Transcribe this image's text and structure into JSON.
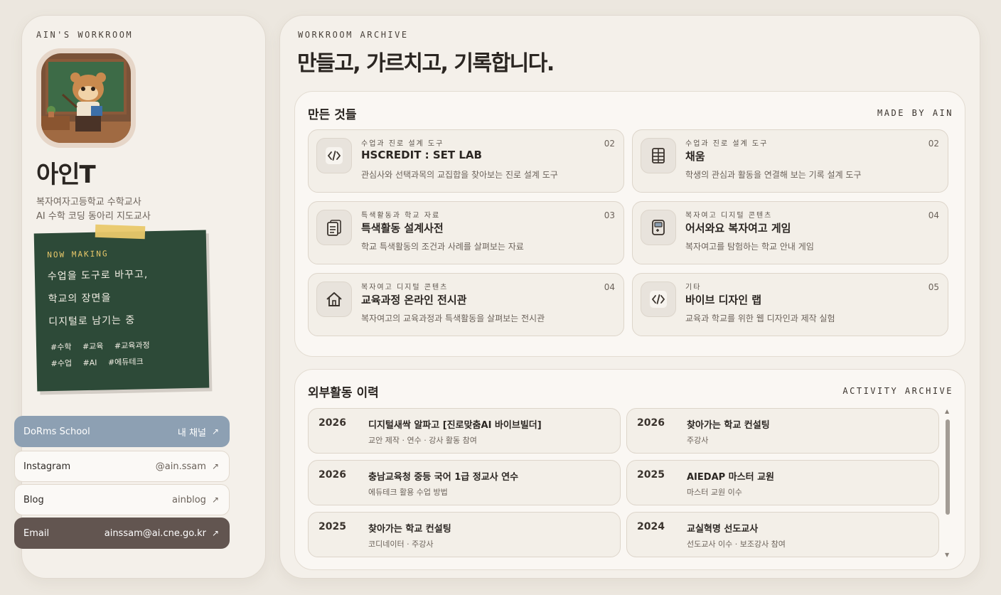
{
  "profile": {
    "eyebrow": "AIN'S WORKROOM",
    "name": "아인T",
    "role_line1": "복자여자고등학교 수학교사",
    "role_line2": "AI 수학 코딩 동아리 지도교사"
  },
  "note": {
    "eyebrow": "NOW MAKING",
    "line1": "수업을 도구로 바꾸고,",
    "line2": "학교의 장면을",
    "line3": "디지털로 남기는 중",
    "tags_row1": [
      "#수학",
      "#교육",
      "#교육과정"
    ],
    "tags_row2": [
      "#수업",
      "#AI",
      "#에듀테크"
    ]
  },
  "links": [
    {
      "label": "DoRms School",
      "value": "내 채널",
      "icon": "external-arrow-icon"
    },
    {
      "label": "Instagram",
      "value": "@ain.ssam",
      "icon": "external-arrow-icon"
    },
    {
      "label": "Blog",
      "value": "ainblog",
      "icon": "external-arrow-icon"
    },
    {
      "label": "Email",
      "value": "ainssam@ai.cne.go.kr",
      "icon": "external-arrow-icon"
    }
  ],
  "archive": {
    "eyebrow": "WORKROOM ARCHIVE",
    "headline": "만들고, 가르치고, 기록합니다."
  },
  "made": {
    "title": "만든 것들",
    "tag": "MADE BY AIN",
    "items": [
      {
        "category": "수업과 진로 설계 도구",
        "title": "HSCREDIT : SET LAB",
        "desc": "관심사와 선택과목의 교집합을 찾아보는 진로 설계 도구",
        "num": "02",
        "icon": "code-icon"
      },
      {
        "category": "수업과 진로 설계 도구",
        "title": "채움",
        "desc": "학생의 관심과 활동을 연결해 보는 기록 설계 도구",
        "num": "02",
        "icon": "grid-icon"
      },
      {
        "category": "특색활동과 학교 자료",
        "title": "특색활동 설계사전",
        "desc": "학교 특색활동의 조건과 사례를 살펴보는 자료",
        "num": "03",
        "icon": "document-icon"
      },
      {
        "category": "복자여고 디지털 콘텐츠",
        "title": "어서와요 복자여고 게임",
        "desc": "복자여고를 탐험하는 학교 안내 게임",
        "num": "04",
        "icon": "game-icon"
      },
      {
        "category": "복자여고 디지털 콘텐츠",
        "title": "교육과정 온라인 전시관",
        "desc": "복자여고의 교육과정과 특색활동을 살펴보는 전시관",
        "num": "04",
        "icon": "home-icon"
      },
      {
        "category": "기타",
        "title": "바이브 디자인 랩",
        "desc": "교육과 학교를 위한 웹 디자인과 제작 실험",
        "num": "05",
        "icon": "code-icon"
      }
    ]
  },
  "activities": {
    "title": "외부활동 이력",
    "tag": "ACTIVITY ARCHIVE",
    "items": [
      {
        "year": "2026",
        "title": "디지털새싹 알파고 [진로맞춤AI 바이브빌더]",
        "desc": "교안 제작 · 연수 · 강사 활동 참여"
      },
      {
        "year": "2026",
        "title": "찾아가는 학교 컨설팅",
        "desc": "주강사"
      },
      {
        "year": "2026",
        "title": "충남교육청 중등 국어 1급 정교사 연수",
        "desc": "에듀테크 활용 수업 방법"
      },
      {
        "year": "2025",
        "title": "AIEDAP 마스터 교원",
        "desc": "마스터 교원 이수"
      },
      {
        "year": "2025",
        "title": "찾아가는 학교 컨설팅",
        "desc": "코디네이터 · 주강사"
      },
      {
        "year": "2024",
        "title": "교실혁명 선도교사",
        "desc": "선도교사 이수 · 보조강사 참여"
      }
    ]
  },
  "colors": {
    "background": "#ece7df",
    "panel": "#f4f0ea",
    "accent_blue": "#8da0b3",
    "accent_brown": "#625550",
    "chalkboard": "#2d4a38",
    "tape": "#e9c86a"
  }
}
